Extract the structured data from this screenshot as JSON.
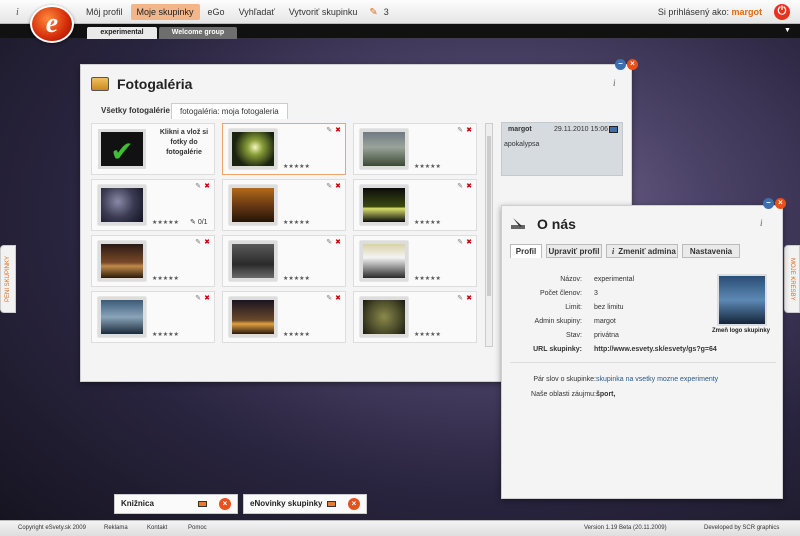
{
  "topbar": {
    "info": "i",
    "logo": "e",
    "nav": [
      "Môj profil",
      "Moje skupinky",
      "eGo",
      "Vyhľadať",
      "Vytvoriť skupinku"
    ],
    "notification_count": "3",
    "signin_label": "Si prihlásený ako:",
    "username": "margot"
  },
  "group_tabs": [
    "experimental",
    "Welcome group"
  ],
  "side_tabs": {
    "left": "PENI SKUPINKY",
    "right": "MOJE KRESBY"
  },
  "fotogaleria": {
    "title": "Fotogaléria",
    "info": "i",
    "tabs": [
      "Všetky fotogalérie",
      "fotogaléria: moja fotogaleria"
    ],
    "upload_text": "Klikni a vlož si fotky do fotogalérie",
    "stars": "★★★★★",
    "rating_count": "0/1",
    "comment": {
      "user": "margot",
      "date": "29.11.2010 15:06",
      "text": "apokalypsa"
    }
  },
  "onas": {
    "title": "O nás",
    "info": "i",
    "tabs": [
      "Profil",
      "Upraviť profil",
      "Zmeniť admina",
      "Nastavenia"
    ],
    "fields": [
      {
        "label": "Názov:",
        "value": "experimental"
      },
      {
        "label": "Počet členov:",
        "value": "3"
      },
      {
        "label": "Limit:",
        "value": "bez limitu"
      },
      {
        "label": "Admin skupiny:",
        "value": "margot"
      },
      {
        "label": "Stav:",
        "value": "privátna"
      },
      {
        "label": "URL skupinky:",
        "value": "http://www.esvety.sk/esvety/gs?g=64"
      }
    ],
    "logo_label": "Zmeň logo skupinky",
    "about_label": "Pár slov o skupinke:",
    "about_value": "skupinka na vsetky mozne experimenty",
    "interests_label": "Naše oblasti záujmu:",
    "interests_value": "šport,"
  },
  "bottom_panels": [
    "Knižnica",
    "eNovinky skupinky"
  ],
  "footer": {
    "copyright": "Copyright eSvety.sk 2009",
    "links": [
      "Reklama",
      "Kontakt",
      "Pomoc"
    ],
    "version": "Version 1.19 Beta (20.11.2009)",
    "developed": "Developed by SCR graphics"
  }
}
